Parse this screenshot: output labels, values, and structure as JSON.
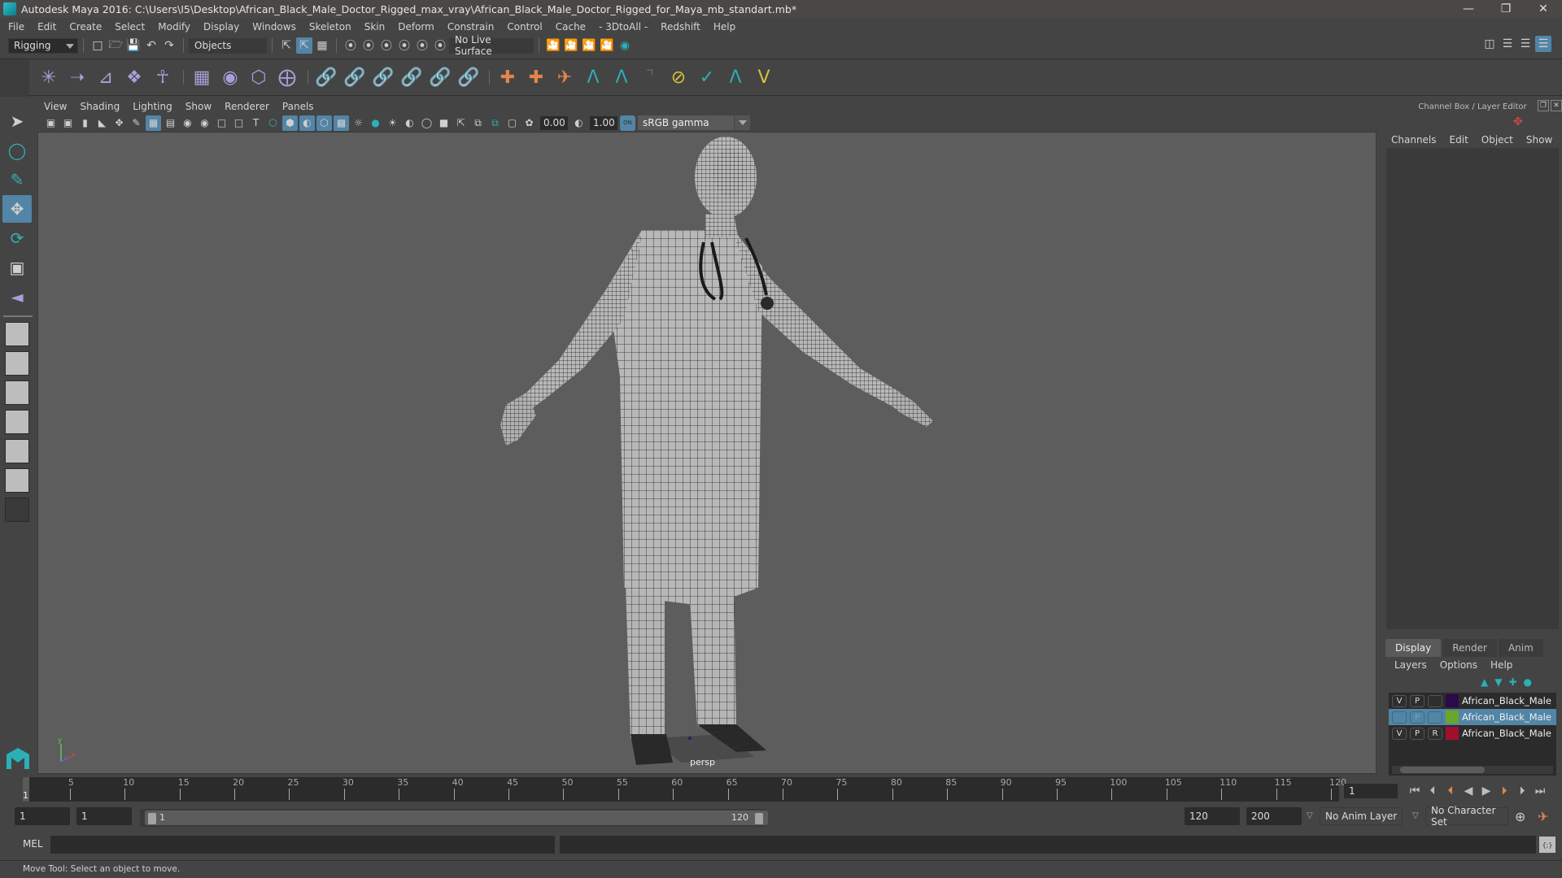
{
  "titlebar": {
    "title": "Autodesk Maya 2016: C:\\Users\\I5\\Desktop\\African_Black_Male_Doctor_Rigged_max_vray\\African_Black_Male_Doctor_Rigged_for_Maya_mb_standart.mb*",
    "minimize": "—",
    "restore": "❐",
    "close": "✕"
  },
  "menubar": [
    "File",
    "Edit",
    "Create",
    "Select",
    "Modify",
    "Display",
    "Windows",
    "Skeleton",
    "Skin",
    "Deform",
    "Constrain",
    "Control",
    "Cache",
    "- 3DtoAll -",
    "Redshift",
    "Help"
  ],
  "statusline": {
    "menuset": "Rigging",
    "selection_mode": "Objects",
    "live_surface": "No Live Surface"
  },
  "viewport": {
    "menu": [
      "View",
      "Shading",
      "Lighting",
      "Show",
      "Renderer",
      "Panels"
    ],
    "exposure": "0.00",
    "gamma": "1.00",
    "color_mgmt_toggle": "ON",
    "color_space": "sRGB gamma",
    "camera_label": "persp",
    "axis": {
      "y": "y",
      "z": "z",
      "x": "x"
    }
  },
  "channel_box": {
    "header": "Channel Box / Layer Editor",
    "menu": [
      "Channels",
      "Edit",
      "Object",
      "Show"
    ]
  },
  "layer_editor": {
    "tabs": [
      "Display",
      "Render",
      "Anim"
    ],
    "active_tab": "Display",
    "menu": [
      "Layers",
      "Options",
      "Help"
    ],
    "layers": [
      {
        "v": "V",
        "p": "P",
        "r": "",
        "color": "#2a0a4a",
        "name": "African_Black_Male_Doctor",
        "selected": false
      },
      {
        "v": "",
        "p": "P",
        "r": "",
        "color": "#6aa62a",
        "name": "African_Black_Male_Doctor",
        "selected": true
      },
      {
        "v": "V",
        "p": "P",
        "r": "R",
        "color": "#a0102c",
        "name": "African_Black_Male_Doctor",
        "selected": false
      }
    ]
  },
  "timeline": {
    "ticks": [
      "5",
      "10",
      "15",
      "20",
      "25",
      "30",
      "35",
      "40",
      "45",
      "50",
      "55",
      "60",
      "65",
      "70",
      "75",
      "80",
      "85",
      "90",
      "95",
      "100",
      "105",
      "110",
      "115",
      "120"
    ],
    "current_frame_marker": "1",
    "current_frame": "1",
    "range_start_outer": "1",
    "range_start_inner": "1",
    "range_slider_start": "1",
    "range_slider_end": "120",
    "range_end_inner": "120",
    "range_end_outer": "200",
    "anim_layer": "No Anim Layer",
    "character_set": "No Character Set"
  },
  "commandline": {
    "language": "MEL",
    "input": ""
  },
  "helpline": "Move Tool: Select an object to move.",
  "colors": {
    "accent": "#5285a6",
    "teal": "#2bb0b8",
    "key_orange": "#e3844c"
  }
}
